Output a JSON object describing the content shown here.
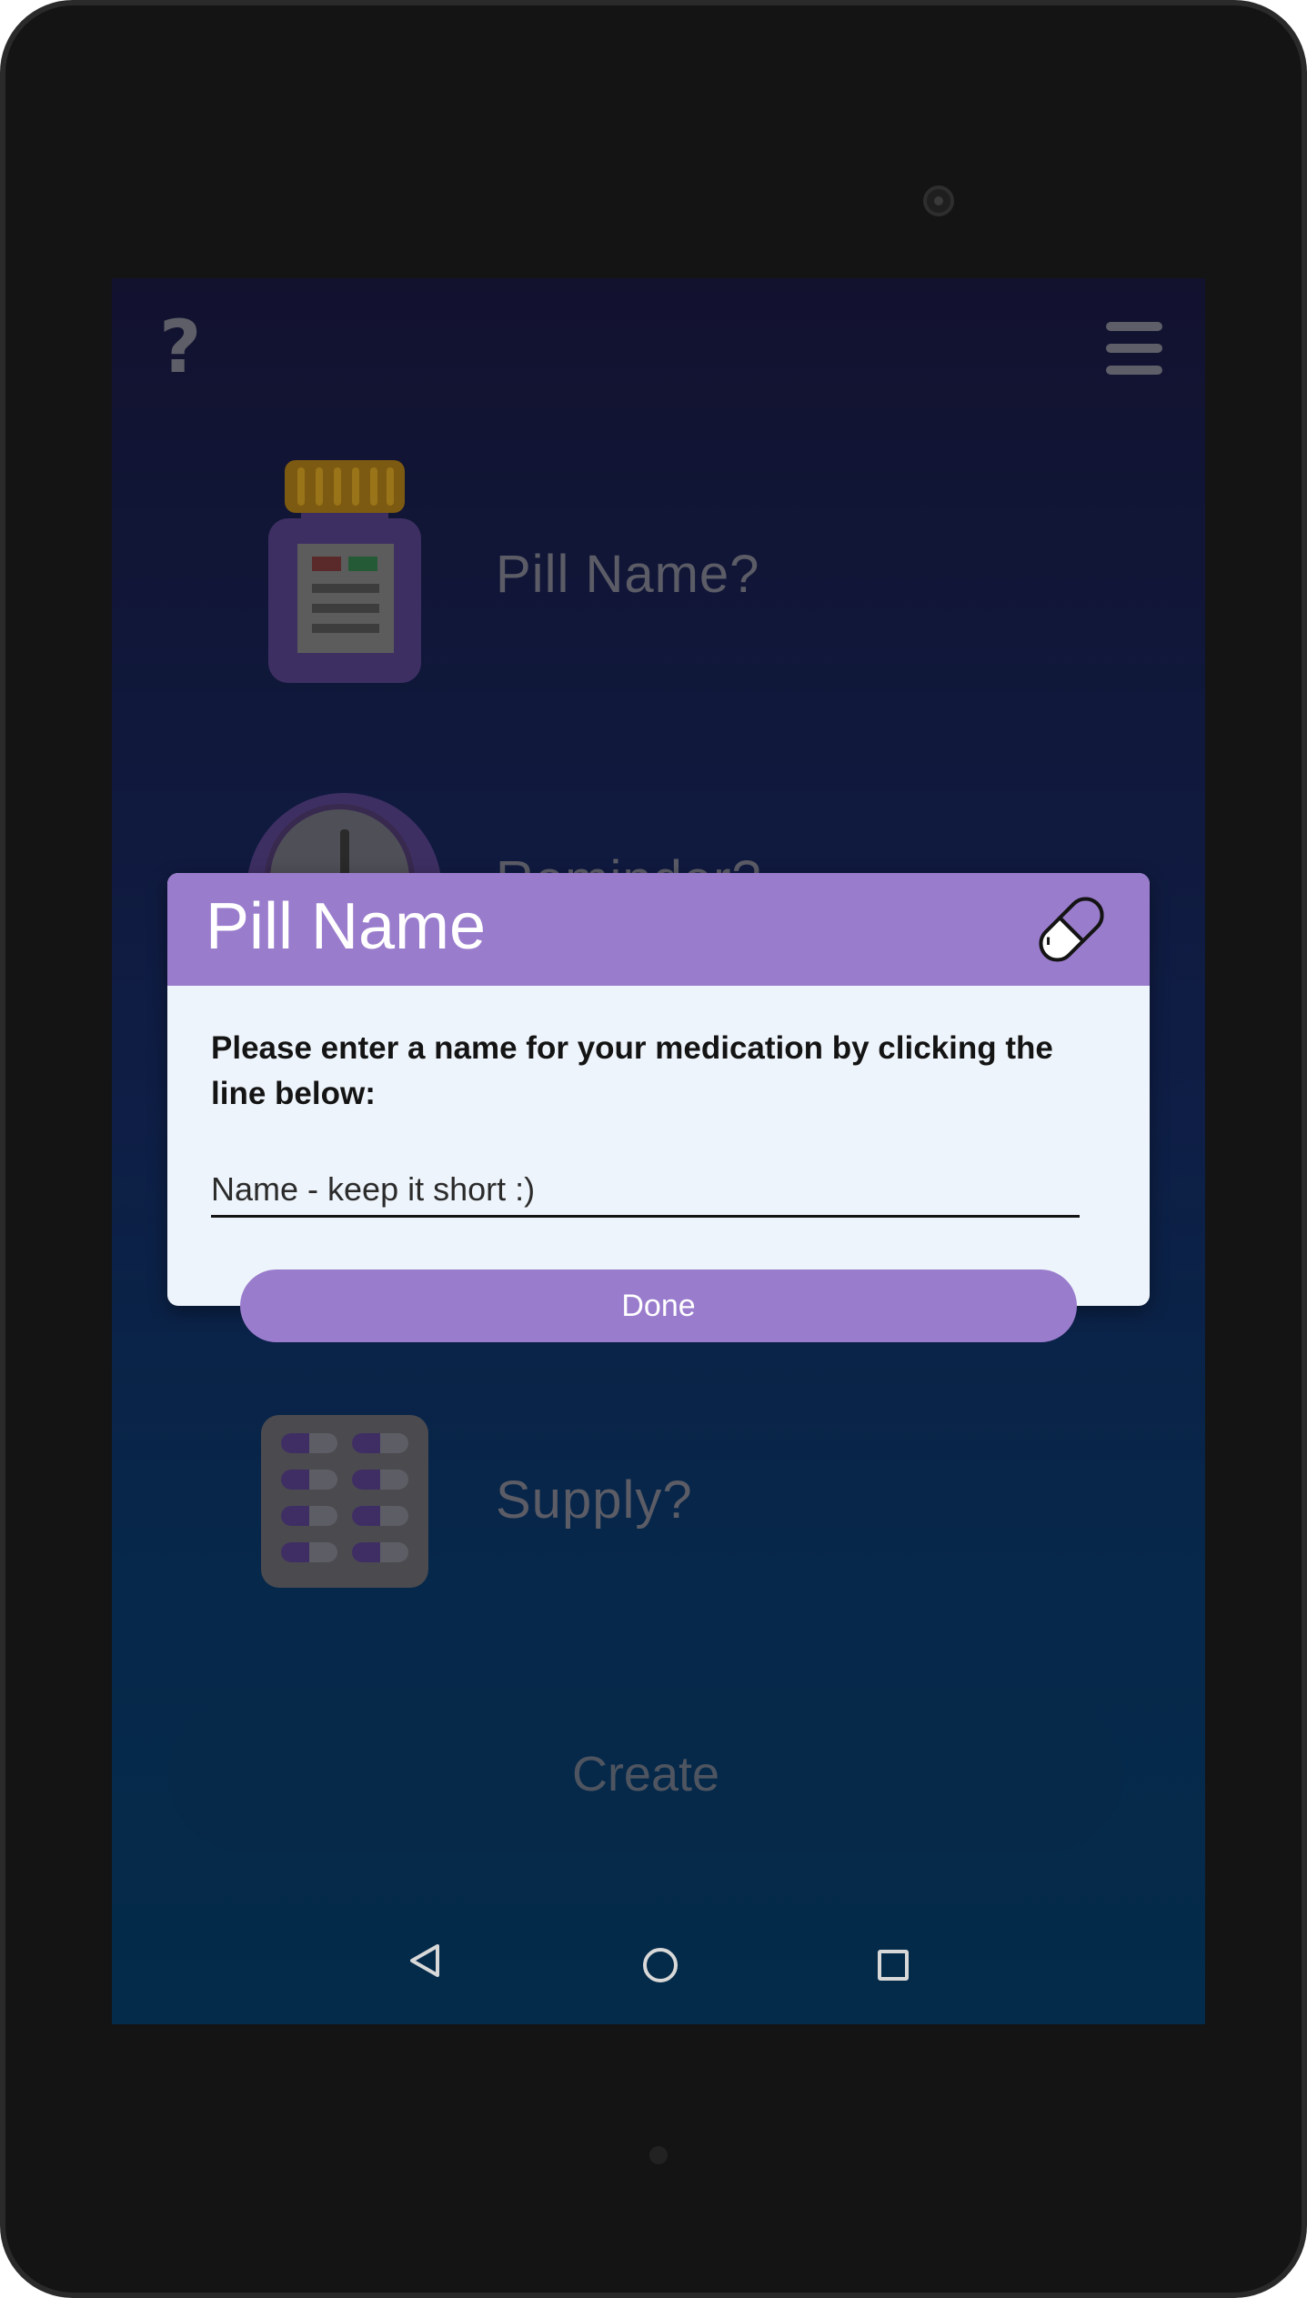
{
  "app": {
    "help_icon": "?",
    "menu_icon": "hamburger-menu-icon"
  },
  "rows": {
    "pill_name_label": "Pill Name?",
    "reminder_label": "Reminder?",
    "supply_label": "Supply?"
  },
  "create_button": "Create",
  "dialog": {
    "title": "Pill Name",
    "icon": "capsule-icon",
    "instructions": "Please enter a name for your medication by clicking the line below:",
    "input_placeholder": "Name - keep it short :)",
    "input_value": "",
    "done_label": "Done"
  },
  "colors": {
    "accent": "#9a7ccd",
    "dialog_background": "#eef4fb",
    "screen_top": "#12122f",
    "screen_bottom": "#042b4a"
  },
  "navigation": [
    "back-icon",
    "home-icon",
    "recent-apps-icon"
  ]
}
